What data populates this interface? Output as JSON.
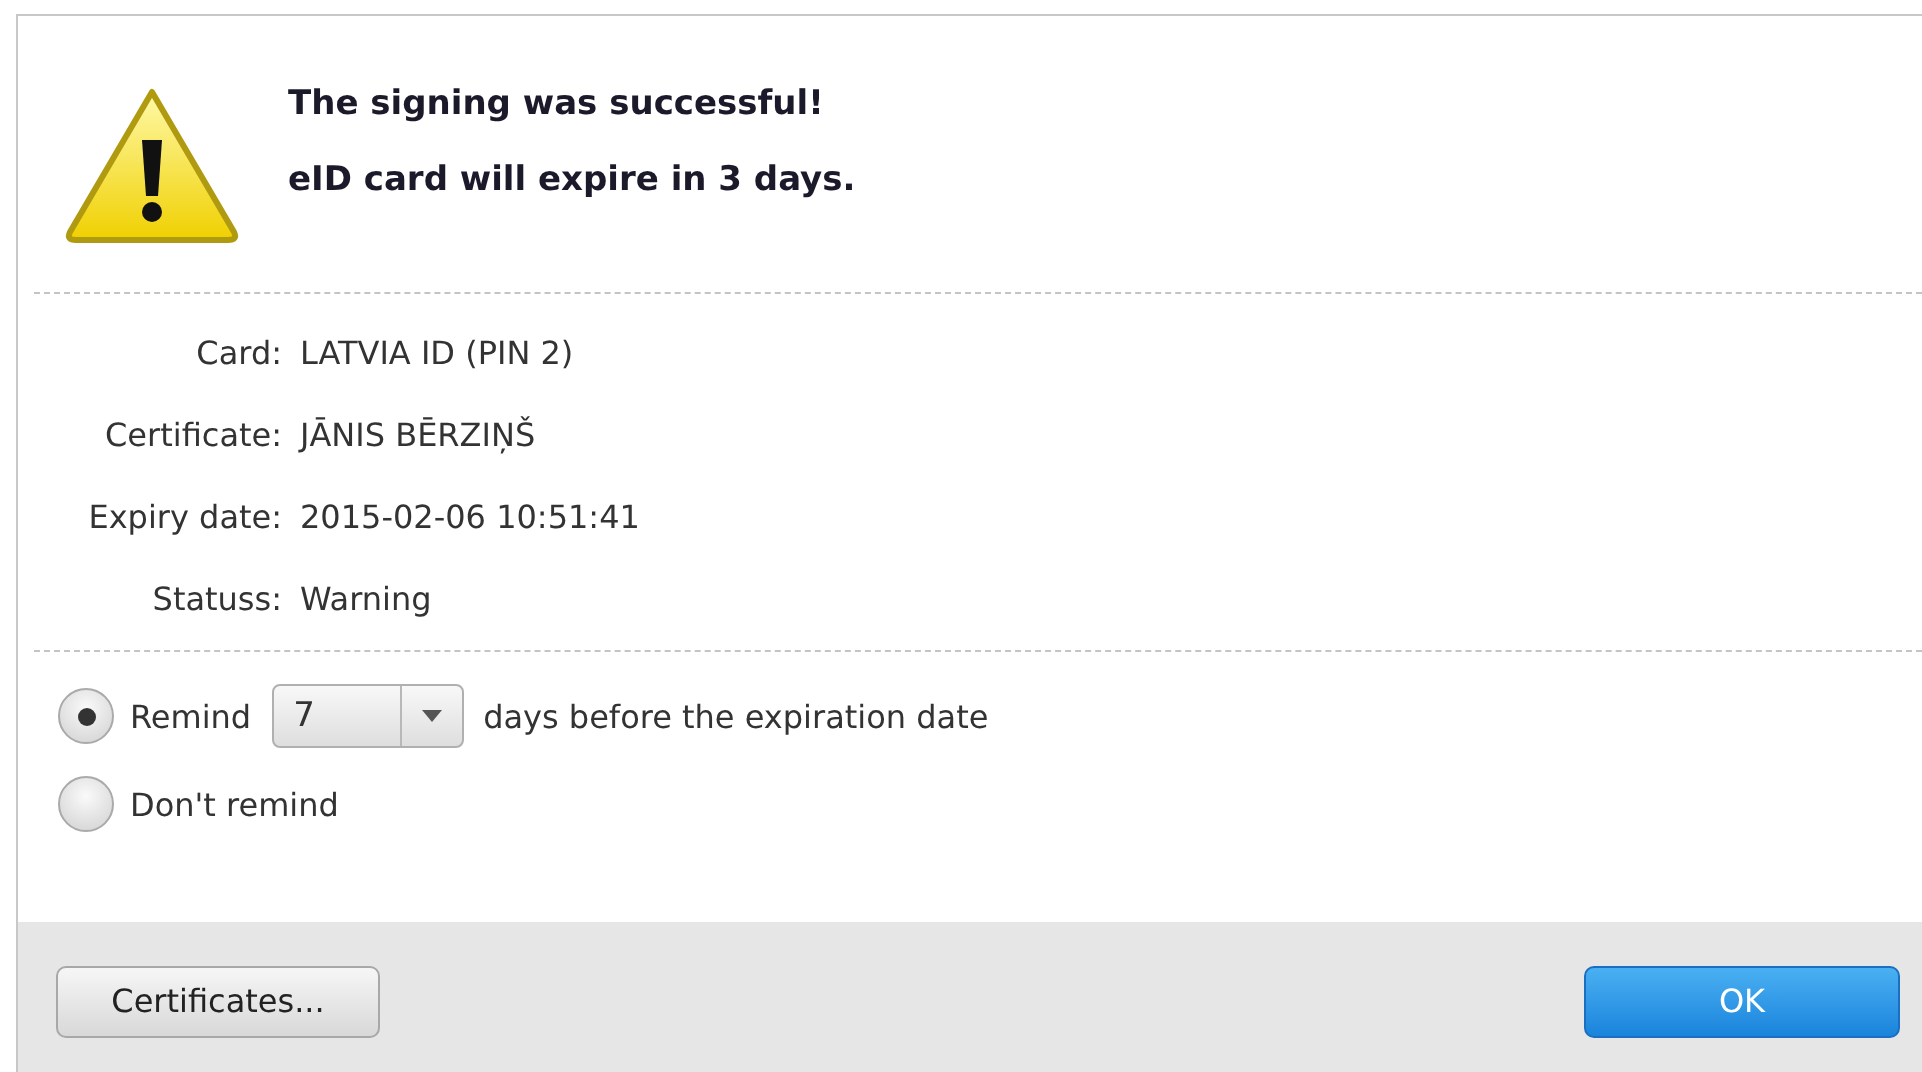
{
  "message": {
    "title": "The signing was successful!",
    "detail": "eID card will expire in 3 days."
  },
  "details": [
    {
      "label": "Card:",
      "value": "LATVIA ID (PIN 2)"
    },
    {
      "label": "Certificate:",
      "value": "JĀNIS BĒRZIŅŠ"
    },
    {
      "label": "Expiry date:",
      "value": "2015-02-06 10:51:41"
    },
    {
      "label": "Statuss:",
      "value": "Warning"
    }
  ],
  "reminder": [
    {
      "kind": "dropdown",
      "label": "Remind",
      "selected": true,
      "value": "7",
      "suffix": "days before the expiration date"
    },
    {
      "kind": "plain",
      "label": "Don't remind",
      "selected": false
    }
  ],
  "buttons": [
    {
      "label": "Certificates...",
      "kind": "secondary"
    },
    {
      "label": "OK",
      "kind": "primary"
    }
  ]
}
